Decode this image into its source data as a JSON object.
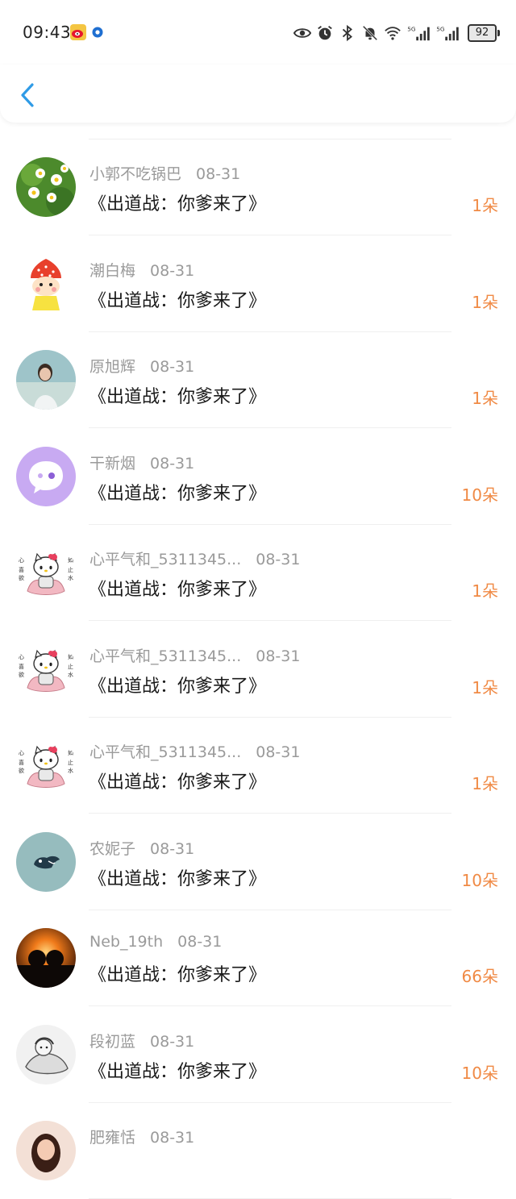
{
  "status_bar": {
    "time": "09:43",
    "battery": "92",
    "icons": [
      "weibo-icon",
      "app-badge-icon",
      "eye-icon",
      "alarm-icon",
      "bluetooth-icon",
      "mute-bell-icon",
      "wifi-icon",
      "signal-5g-icon",
      "signal-5g-icon-2",
      "battery-icon"
    ]
  },
  "header": {
    "back_icon": "chevron-left-icon"
  },
  "colors": {
    "accent_blue": "#2f9be6",
    "count_orange": "#f08a45",
    "meta_gray": "#9a9a9a"
  },
  "list": [
    {
      "name": "小郭不吃锅巴",
      "date": "08-31",
      "title": "《出道战：你爹来了》",
      "count": "1朵",
      "avatar": "daisy-avatar"
    },
    {
      "name": "潮白梅",
      "date": "08-31",
      "title": "《出道战：你爹来了》",
      "count": "1朵",
      "avatar": "strawberry-girl-avatar"
    },
    {
      "name": "原旭辉",
      "date": "08-31",
      "title": "《出道战：你爹来了》",
      "count": "1朵",
      "avatar": "photo-avatar"
    },
    {
      "name": "干新烟",
      "date": "08-31",
      "title": "《出道战：你爹来了》",
      "count": "10朵",
      "avatar": "chat-bubble-avatar"
    },
    {
      "name": "心平气和_5311345...",
      "date": "08-31",
      "title": "《出道战：你爹来了》",
      "count": "1朵",
      "avatar": "hello-kitty-avatar"
    },
    {
      "name": "心平气和_5311345...",
      "date": "08-31",
      "title": "《出道战：你爹来了》",
      "count": "1朵",
      "avatar": "hello-kitty-avatar"
    },
    {
      "name": "心平气和_5311345...",
      "date": "08-31",
      "title": "《出道战：你爹来了》",
      "count": "1朵",
      "avatar": "hello-kitty-avatar"
    },
    {
      "name": "农妮子",
      "date": "08-31",
      "title": "《出道战：你爹来了》",
      "count": "10朵",
      "avatar": "bird-avatar"
    },
    {
      "name": "Neb_19th",
      "date": "08-31",
      "title": "《出道战：你爹来了》",
      "count": "66朵",
      "avatar": "sunset-couple-avatar"
    },
    {
      "name": "段初蓝",
      "date": "08-31",
      "title": "《出道战：你爹来了》",
      "count": "10朵",
      "avatar": "sketch-avatar"
    },
    {
      "name": "肥雍恬",
      "date": "08-31",
      "title": "",
      "count": "",
      "avatar": "girl-photo-avatar"
    }
  ]
}
